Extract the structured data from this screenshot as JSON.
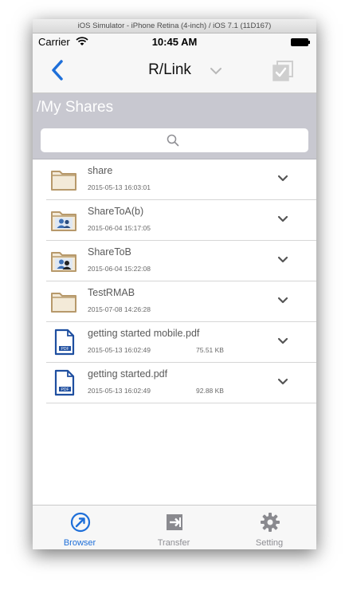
{
  "simulator": {
    "window_title": "iOS Simulator - iPhone Retina (4-inch) / iOS 7.1 (11D167)"
  },
  "status_bar": {
    "carrier": "Carrier",
    "time": "10:45 AM"
  },
  "nav": {
    "title": "R/Link",
    "back_icon": "chevron-left-icon",
    "select_icon": "checkbox-select-icon"
  },
  "path": {
    "current": "/My Shares"
  },
  "search": {
    "placeholder": ""
  },
  "files": [
    {
      "name": "share",
      "date": "2015-05-13 16:03:01",
      "size": "",
      "type": "folder"
    },
    {
      "name": "ShareToA(b)",
      "date": "2015-06-04 15:17:05",
      "size": "",
      "type": "shared-folder"
    },
    {
      "name": "ShareToB",
      "date": "2015-06-04 15:22:08",
      "size": "",
      "type": "shared-folder"
    },
    {
      "name": "TestRMAB",
      "date": "2015-07-08 14:26:28",
      "size": "",
      "type": "folder"
    },
    {
      "name": "getting started mobile.pdf",
      "date": "2015-05-13 16:02:49",
      "size": "75.51 KB",
      "type": "pdf"
    },
    {
      "name": "getting started.pdf",
      "date": "2015-05-13 16:02:49",
      "size": "92.88 KB",
      "type": "pdf"
    }
  ],
  "tabs": [
    {
      "label": "Browser",
      "icon": "compass-icon",
      "active": true
    },
    {
      "label": "Transfer",
      "icon": "transfer-icon",
      "active": false
    },
    {
      "label": "Setting",
      "icon": "gear-icon",
      "active": false
    }
  ],
  "colors": {
    "accent": "#1e6fd9",
    "path_bar": "#c8c8d0",
    "folder": "#b7996b",
    "pdf": "#1f4fa0"
  }
}
